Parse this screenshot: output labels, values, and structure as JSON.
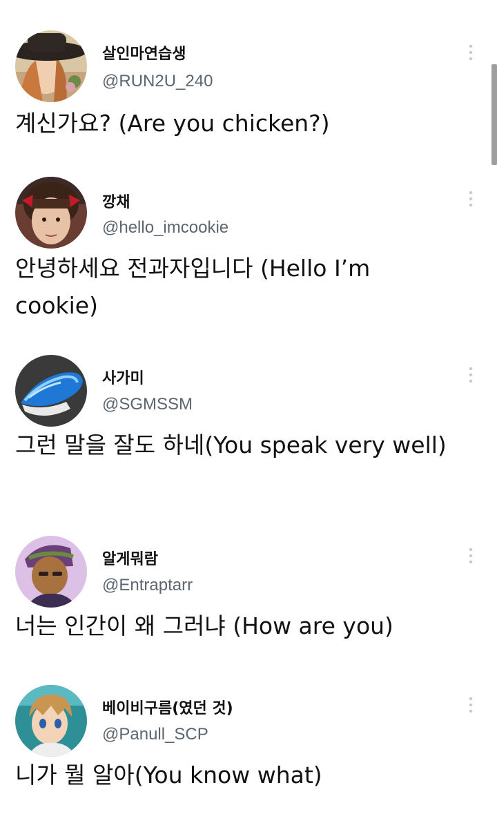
{
  "tweets": [
    {
      "display_name": "살인마연습생",
      "handle": "@RUN2U_240",
      "text": "계신가요? (Are you chicken?)",
      "avatar_icon": "avatar-illustrated-girl-hat"
    },
    {
      "display_name": "깡채",
      "handle": "@hello_imcookie",
      "text": "안녕하세요 전과자입니다 (Hello I’m cookie)",
      "avatar_icon": "avatar-girl-red-bows"
    },
    {
      "display_name": "사가미",
      "handle": "@SGMSSM",
      "text": "그런 말을 잘도 하네(You speak very well)",
      "avatar_icon": "avatar-sushi"
    },
    {
      "display_name": "알게뭐람",
      "handle": "@Entraptarr",
      "text": "너는 인간이 왜 그러냐 (How are you)",
      "avatar_icon": "avatar-cartoon-character"
    },
    {
      "display_name": "베이비구름(였던 것)",
      "handle": "@Panull_SCP",
      "text": "니가 뭘 알아(You know what)",
      "avatar_icon": "avatar-anime-boy"
    }
  ],
  "more_icon": "vertical-ellipsis-icon",
  "colors": {
    "background": "#ffffff",
    "text": "#111111",
    "handle": "#5b6670",
    "icon": "#c4c9ce",
    "scrollbar": "#9e9e9e"
  }
}
